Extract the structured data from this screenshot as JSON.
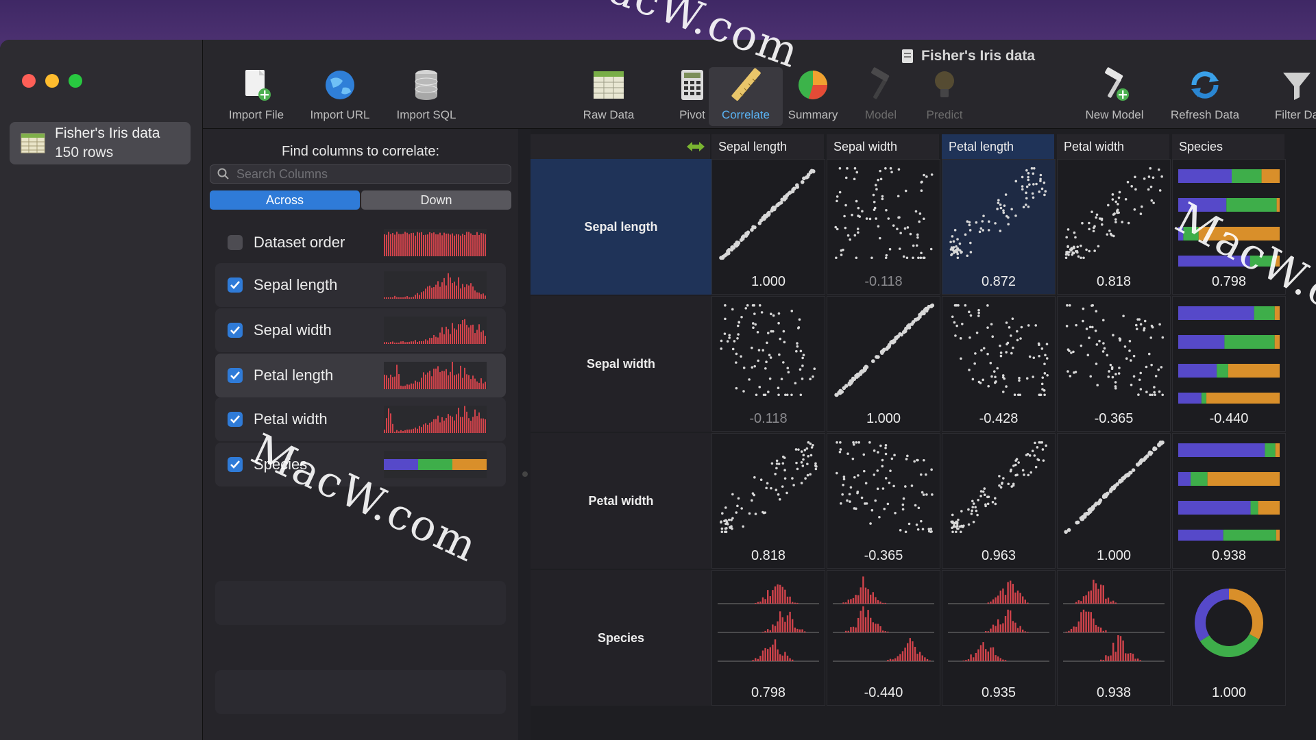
{
  "window_title": "Fisher's Iris data",
  "dataset": {
    "name": "Fisher's Iris data",
    "rows": "150 rows"
  },
  "toolbar": [
    {
      "id": "import-file",
      "label": "Import File",
      "icon": "document-plus-icon",
      "state": "normal"
    },
    {
      "id": "import-url",
      "label": "Import URL",
      "icon": "globe-icon",
      "state": "normal"
    },
    {
      "id": "import-sql",
      "label": "Import SQL",
      "icon": "database-icon",
      "state": "normal"
    },
    {
      "id": "raw-data",
      "label": "Raw Data",
      "icon": "table-icon",
      "state": "normal"
    },
    {
      "id": "pivot",
      "label": "Pivot",
      "icon": "calculator-icon",
      "state": "normal"
    },
    {
      "id": "correlate",
      "label": "Correlate",
      "icon": "ruler-icon",
      "state": "active"
    },
    {
      "id": "summary",
      "label": "Summary",
      "icon": "pie-chart-icon",
      "state": "normal"
    },
    {
      "id": "model",
      "label": "Model",
      "icon": "hammer-icon",
      "state": "disabled"
    },
    {
      "id": "predict",
      "label": "Predict",
      "icon": "lightbulb-icon",
      "state": "disabled"
    },
    {
      "id": "new-model",
      "label": "New Model",
      "icon": "hammer-plus-icon",
      "state": "normal"
    },
    {
      "id": "refresh-data",
      "label": "Refresh Data",
      "icon": "refresh-icon",
      "state": "normal"
    },
    {
      "id": "filter-data",
      "label": "Filter Da",
      "icon": "funnel-icon",
      "state": "normal"
    }
  ],
  "panel": {
    "heading": "Find columns to correlate:",
    "search_placeholder": "Search Columns",
    "segments": {
      "across": "Across",
      "down": "Down",
      "selected": "Across"
    },
    "columns": [
      {
        "label": "Dataset order",
        "checked": false
      },
      {
        "label": "Sepal length",
        "checked": true
      },
      {
        "label": "Sepal width",
        "checked": true
      },
      {
        "label": "Petal length",
        "checked": true,
        "selected": true
      },
      {
        "label": "Petal width",
        "checked": true
      },
      {
        "label": "Species",
        "checked": true
      }
    ]
  },
  "matrix": {
    "col_headers": [
      "Sepal length",
      "Sepal width",
      "Petal length",
      "Petal width",
      "Species"
    ],
    "row_headers": [
      "Sepal length",
      "Sepal width",
      "Petal width",
      "Species"
    ],
    "values": [
      [
        "1.000",
        "-0.118",
        "0.872",
        "0.818",
        "0.798"
      ],
      [
        "-0.118",
        "1.000",
        "-0.428",
        "-0.365",
        "-0.440"
      ],
      [
        "0.818",
        "-0.365",
        "0.963",
        "1.000",
        "0.938"
      ],
      [
        "0.798",
        "-0.440",
        "0.935",
        "0.938",
        "1.000"
      ]
    ]
  },
  "colors": {
    "accent": "#2f7bd8",
    "hist": "#d0434b",
    "species": [
      "#5649c9",
      "#3eae4a",
      "#d98f2a"
    ]
  },
  "watermark": "MacW.com"
}
